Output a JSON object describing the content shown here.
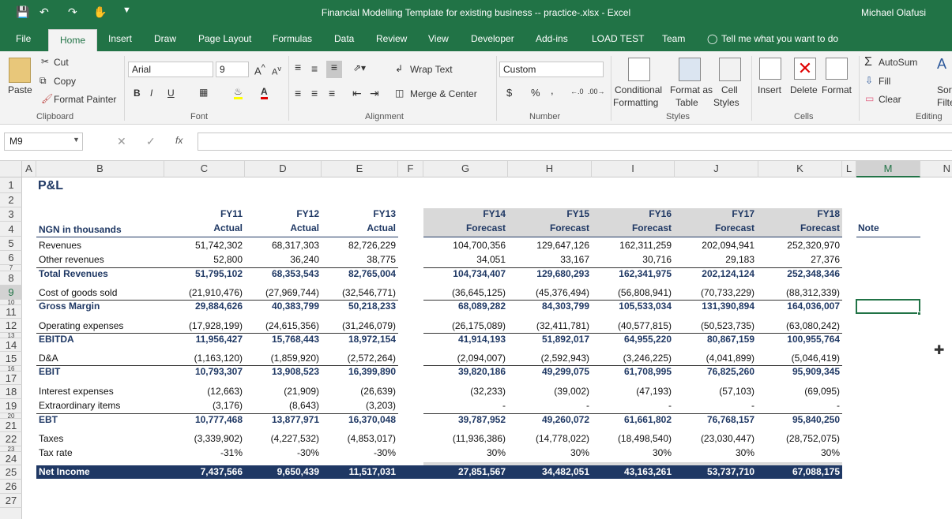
{
  "window": {
    "title": "Financial Modelling Template for existing business -- practice-.xlsx - Excel",
    "user": "Michael Olafusi"
  },
  "tabs": [
    "File",
    "Home",
    "Insert",
    "Draw",
    "Page Layout",
    "Formulas",
    "Data",
    "Review",
    "View",
    "Developer",
    "Add-ins",
    "LOAD TEST",
    "Team",
    "Tell me what you want to do"
  ],
  "ribbon": {
    "clipboard": {
      "paste": "Paste",
      "cut": "Cut",
      "copy": "Copy",
      "format_painter": "Format Painter",
      "label": "Clipboard"
    },
    "font": {
      "name": "Arial",
      "size": "9",
      "bold": "B",
      "italic": "I",
      "underline": "U",
      "label": "Font"
    },
    "alignment": {
      "wrap": "Wrap Text",
      "merge": "Merge & Center",
      "label": "Alignment"
    },
    "number": {
      "format": "Custom",
      "currency": "$",
      "percent": "%",
      "comma": ",",
      "label": "Number"
    },
    "styles": {
      "conditional": "Conditional",
      "conditional2": "Formatting",
      "format_as": "Format as",
      "format_as2": "Table",
      "cell": "Cell",
      "cell2": "Styles",
      "label": "Styles"
    },
    "cells": {
      "insert": "Insert",
      "delete": "Delete",
      "format": "Format",
      "label": "Cells"
    },
    "editing": {
      "autosum": "AutoSum",
      "fill": "Fill",
      "clear": "Clear",
      "sort": "Sort",
      "filter": "Filte",
      "label": "Editing"
    }
  },
  "formula_bar": {
    "name_box": "M9",
    "fx": "fx",
    "cancel": "✕",
    "enter": "✓",
    "value": ""
  },
  "columns": [
    "A",
    "B",
    "C",
    "D",
    "E",
    "F",
    "G",
    "H",
    "I",
    "J",
    "K",
    "L",
    "M",
    "N"
  ],
  "rows": [
    "1",
    "2",
    "3",
    "4",
    "5",
    "6",
    "7",
    "8",
    "9",
    "10",
    "11",
    "12",
    "13",
    "14",
    "15",
    "16",
    "17",
    "18",
    "19",
    "20",
    "21",
    "22",
    "23",
    "24",
    "25",
    "26",
    "27"
  ],
  "sheet": {
    "title": "P&L",
    "unit_label": "NGN in thousands",
    "note_label": "Note",
    "periods": [
      {
        "fy": "FY11",
        "kind": "Actual"
      },
      {
        "fy": "FY12",
        "kind": "Actual"
      },
      {
        "fy": "FY13",
        "kind": "Actual"
      },
      {
        "fy": "FY14",
        "kind": "Forecast"
      },
      {
        "fy": "FY15",
        "kind": "Forecast"
      },
      {
        "fy": "FY16",
        "kind": "Forecast"
      },
      {
        "fy": "FY17",
        "kind": "Forecast"
      },
      {
        "fy": "FY18",
        "kind": "Forecast"
      }
    ],
    "lines": [
      {
        "label": "Revenues",
        "bold": false,
        "vals": [
          "51,742,302",
          "68,317,303",
          "82,726,229",
          "104,700,356",
          "129,647,126",
          "162,311,259",
          "202,094,941",
          "252,320,970"
        ]
      },
      {
        "label": "Other revenues",
        "bold": false,
        "vals": [
          "52,800",
          "36,240",
          "38,775",
          "34,051",
          "33,167",
          "30,716",
          "29,183",
          "27,376"
        ]
      },
      {
        "label": "Total Revenues",
        "bold": true,
        "vals": [
          "51,795,102",
          "68,353,543",
          "82,765,004",
          "104,734,407",
          "129,680,293",
          "162,341,975",
          "202,124,124",
          "252,348,346"
        ]
      },
      {
        "label": "Cost of goods sold",
        "bold": false,
        "vals": [
          "(21,910,476)",
          "(27,969,744)",
          "(32,546,771)",
          "(36,645,125)",
          "(45,376,494)",
          "(56,808,941)",
          "(70,733,229)",
          "(88,312,339)"
        ]
      },
      {
        "label": "Gross Margin",
        "bold": true,
        "vals": [
          "29,884,626",
          "40,383,799",
          "50,218,233",
          "68,089,282",
          "84,303,799",
          "105,533,034",
          "131,390,894",
          "164,036,007"
        ]
      },
      {
        "label": "Operating expenses",
        "bold": false,
        "vals": [
          "(17,928,199)",
          "(24,615,356)",
          "(31,246,079)",
          "(26,175,089)",
          "(32,411,781)",
          "(40,577,815)",
          "(50,523,735)",
          "(63,080,242)"
        ]
      },
      {
        "label": "EBITDA",
        "bold": true,
        "vals": [
          "11,956,427",
          "15,768,443",
          "18,972,154",
          "41,914,193",
          "51,892,017",
          "64,955,220",
          "80,867,159",
          "100,955,764"
        ]
      },
      {
        "label": "D&A",
        "bold": false,
        "vals": [
          "(1,163,120)",
          "(1,859,920)",
          "(2,572,264)",
          "(2,094,007)",
          "(2,592,943)",
          "(3,246,225)",
          "(4,041,899)",
          "(5,046,419)"
        ]
      },
      {
        "label": "EBIT",
        "bold": true,
        "vals": [
          "10,793,307",
          "13,908,523",
          "16,399,890",
          "39,820,186",
          "49,299,075",
          "61,708,995",
          "76,825,260",
          "95,909,345"
        ]
      },
      {
        "label": "Interest expenses",
        "bold": false,
        "vals": [
          "(12,663)",
          "(21,909)",
          "(26,639)",
          "(32,233)",
          "(39,002)",
          "(47,193)",
          "(57,103)",
          "(69,095)"
        ]
      },
      {
        "label": "Extraordinary items",
        "bold": false,
        "vals": [
          "(3,176)",
          "(8,643)",
          "(3,203)",
          "-",
          "-",
          "-",
          "-",
          "-"
        ]
      },
      {
        "label": "EBT",
        "bold": true,
        "vals": [
          "10,777,468",
          "13,877,971",
          "16,370,048",
          "39,787,952",
          "49,260,072",
          "61,661,802",
          "76,768,157",
          "95,840,250"
        ]
      },
      {
        "label": "Taxes",
        "bold": false,
        "vals": [
          "(3,339,902)",
          "(4,227,532)",
          "(4,853,017)",
          "(11,936,386)",
          "(14,778,022)",
          "(18,498,540)",
          "(23,030,447)",
          "(28,752,075)"
        ]
      },
      {
        "label": "Tax rate",
        "bold": false,
        "vals": [
          "-31%",
          "-30%",
          "-30%",
          "30%",
          "30%",
          "30%",
          "30%",
          "30%"
        ]
      },
      {
        "label": "Net Income",
        "bold": true,
        "vals": [
          "7,437,566",
          "9,650,439",
          "11,517,031",
          "27,851,567",
          "34,482,051",
          "43,163,261",
          "53,737,710",
          "67,088,175"
        ]
      }
    ]
  },
  "colors": {
    "excel_green": "#217346",
    "navy": "#1f3864",
    "forecast_grey": "#d9d9d9"
  }
}
